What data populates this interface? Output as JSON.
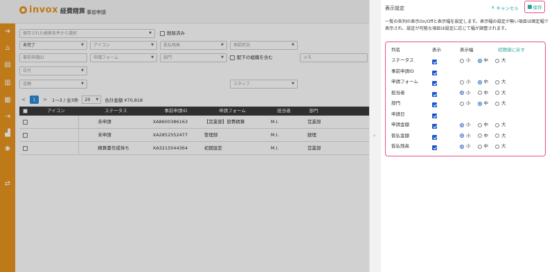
{
  "app": {
    "logo_text": "invox",
    "logo_subtitle": "経費精算",
    "page_label": "事前申請"
  },
  "filters": {
    "saved_search_placeholder": "保存された検索条件から選択",
    "show_deleted_label": "削除済み",
    "status_value": "未完了",
    "icon_placeholder": "アイコン",
    "advance_balance_placeholder": "仮払残高",
    "approval_status_placeholder": "承認状況",
    "request_id_placeholder": "事前申請ID",
    "form_placeholder": "申請フォーム",
    "department_placeholder": "部門",
    "include_sub_org_label": "配下の組織を含む",
    "memo_placeholder": "メモ",
    "date_placeholder": "日付",
    "amount_placeholder": "金額",
    "staff_placeholder": "スタッフ"
  },
  "pager": {
    "prev": "<",
    "page": "1",
    "next": ">",
    "range": "1〜3 / 全3件",
    "page_size": "20",
    "total": "合計金額 ¥70,818"
  },
  "table": {
    "headers": [
      "アイコン",
      "ステータス",
      "事前申請ID",
      "申請フォーム",
      "担当者",
      "部門"
    ],
    "rows": [
      {
        "status": "未申請",
        "id": "XA8600386163",
        "form": "【営業部】旅費精算",
        "owner": "M.I.",
        "dept": "営業部"
      },
      {
        "status": "未申請",
        "id": "XA2852552477",
        "form": "管理部",
        "owner": "M.I.",
        "dept": "経理"
      },
      {
        "status": "精算書作成待ち",
        "id": "XA3215044364",
        "form": "初期設定",
        "owner": "M.I.",
        "dept": "営業部"
      }
    ]
  },
  "panel": {
    "title": "表示設定",
    "cancel_label": "キャンセル",
    "save_label": "保存",
    "description": "一覧の各列の表示On/Offと表示幅を設定します。表示幅の設定が無い項目は固定幅で表示され、設定が可能な項目は設定に応じて幅が調整されます。",
    "col_header_name": "列名",
    "col_header_show": "表示",
    "col_header_width": "表示幅",
    "reset_label": "初期値に戻す",
    "width_options": [
      "小",
      "中",
      "大"
    ],
    "columns": [
      {
        "name": "ステータス",
        "show": true,
        "width": "中"
      },
      {
        "name": "事前申請ID",
        "show": true,
        "width": null
      },
      {
        "name": "申請フォーム",
        "show": true,
        "width": "中"
      },
      {
        "name": "担当者",
        "show": true,
        "width": "小"
      },
      {
        "name": "部門",
        "show": true,
        "width": "中"
      },
      {
        "name": "申請日",
        "show": true,
        "width": null
      },
      {
        "name": "申請金額",
        "show": true,
        "width": "小"
      },
      {
        "name": "仮払金額",
        "show": true,
        "width": "小"
      },
      {
        "name": "仮払残高",
        "show": true,
        "width": "小"
      }
    ]
  },
  "colors": {
    "sidebar": "#e8951e",
    "accent_teal": "#2aa39a",
    "highlight": "#e64f8b",
    "checkbox": "#1a56c9",
    "page_active": "#2b8ad6"
  }
}
